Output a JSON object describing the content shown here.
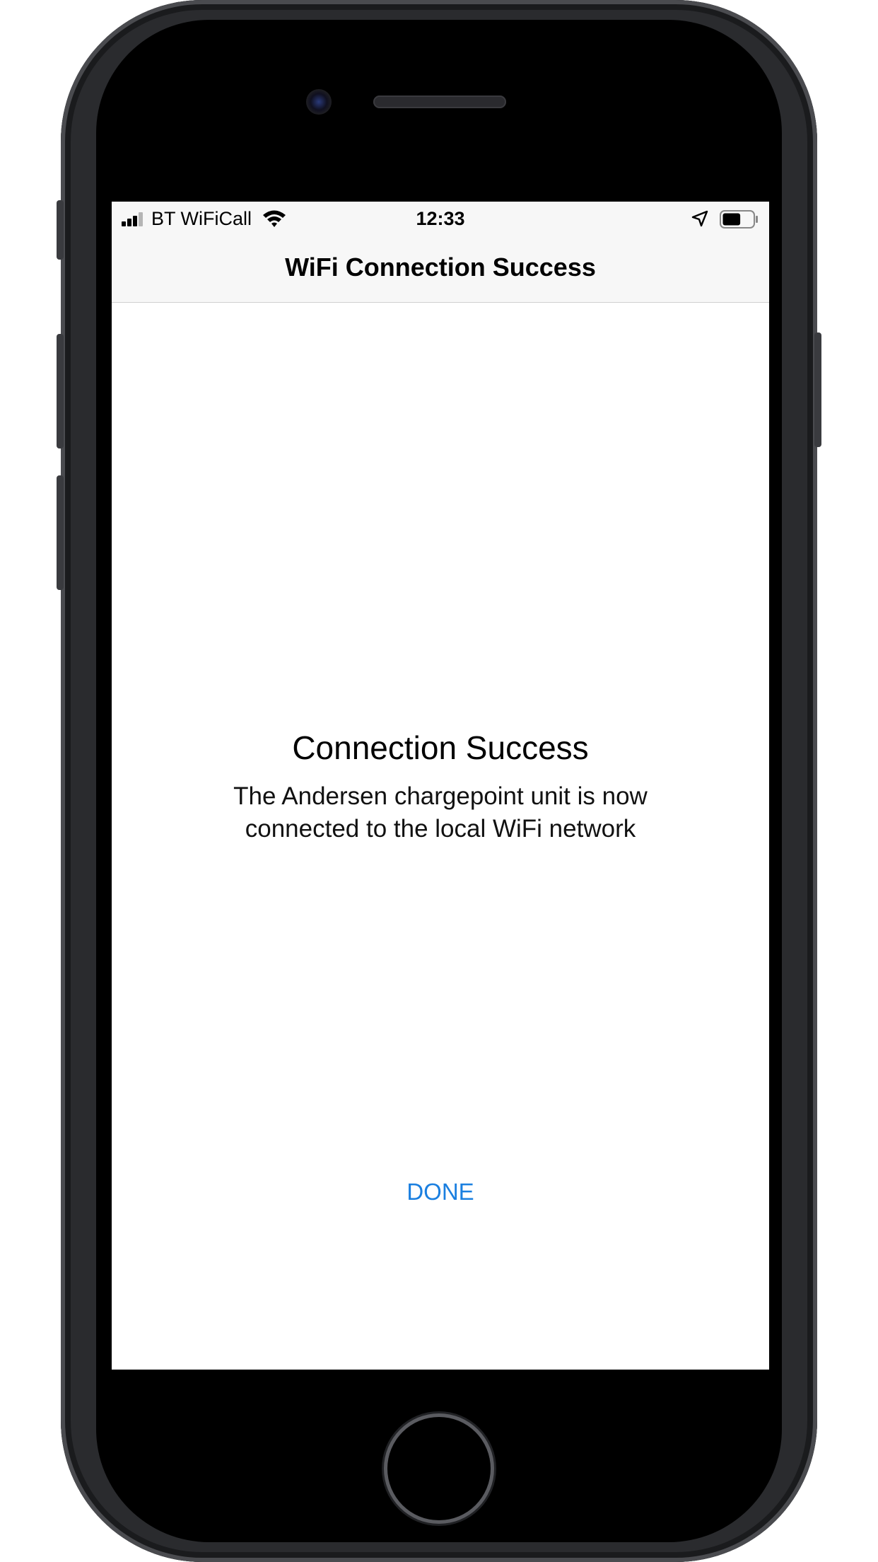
{
  "status_bar": {
    "carrier": "BT WiFiCall",
    "time": "12:33",
    "signal_bars_filled": 3,
    "signal_bars_total": 4,
    "battery_level": 0.6,
    "icons": [
      "signal-icon",
      "wifi-icon",
      "location-arrow-icon",
      "battery-icon"
    ]
  },
  "nav": {
    "title": "WiFi Connection Success"
  },
  "content": {
    "heading": "Connection Success",
    "message": "The Andersen chargepoint unit is now connected to the local WiFi network"
  },
  "actions": {
    "done_label": "DONE"
  },
  "colors": {
    "accent": "#1a7fe0",
    "bar_background": "#f7f7f7",
    "device_frame": "#2a2b2e"
  }
}
